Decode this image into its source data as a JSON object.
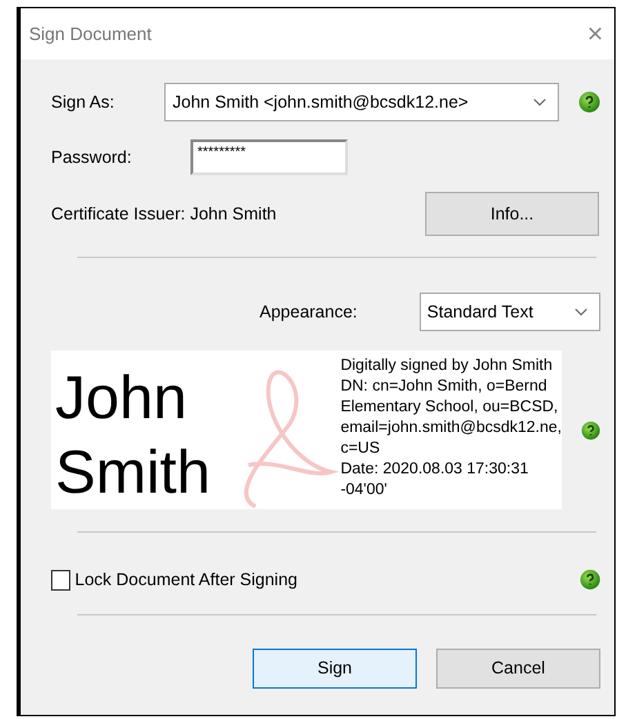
{
  "window": {
    "title": "Sign Document",
    "close": "×"
  },
  "sign_as": {
    "label": "Sign As:",
    "value": "John Smith <john.smith@bcsdk12.ne>"
  },
  "password": {
    "label": "Password:",
    "value": "*********"
  },
  "certificate_issuer": "Certificate Issuer: John Smith",
  "info_button": "Info...",
  "appearance": {
    "label": "Appearance:",
    "value": "Standard Text"
  },
  "preview": {
    "name_lines": [
      "John",
      "Smith"
    ],
    "details": [
      "Digitally signed by John Smith",
      "DN: cn=John Smith, o=Bernd",
      "Elementary School, ou=BCSD,",
      "email=john.smith@bcsdk12.ne,",
      "c=US",
      "Date: 2020.08.03 17:30:31",
      "-04'00'"
    ]
  },
  "lock": {
    "label": "Lock Document After Signing",
    "checked": false
  },
  "buttons": [
    {
      "label": "Sign",
      "default": true
    },
    {
      "label": "Cancel",
      "default": false
    }
  ]
}
